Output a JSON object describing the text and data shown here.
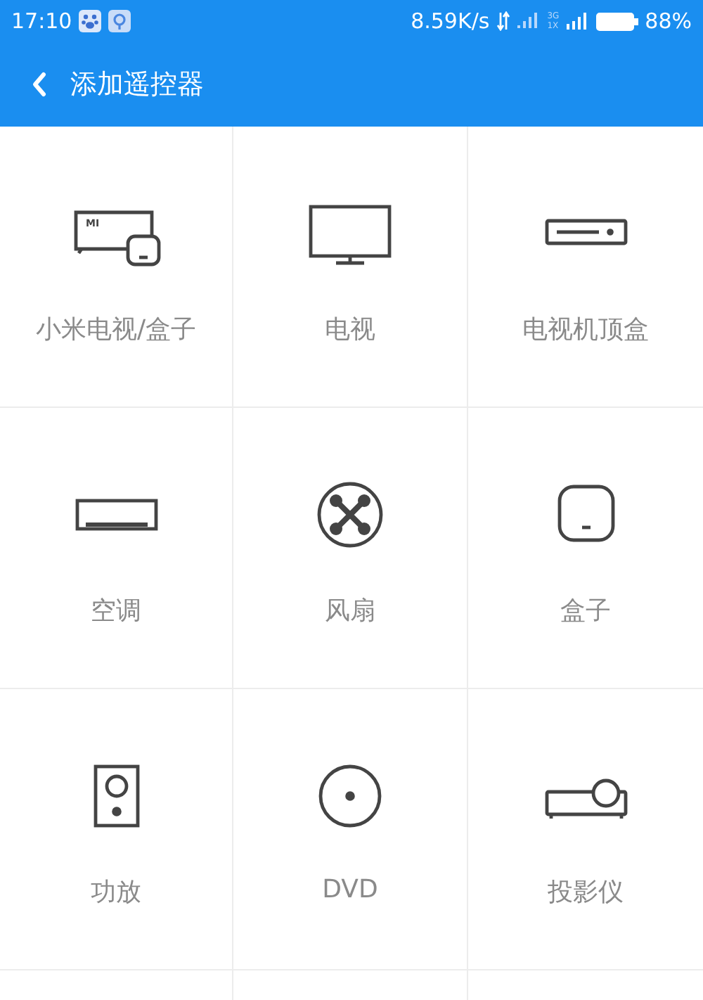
{
  "status_bar": {
    "time": "17:10",
    "speed": "8.59K/s",
    "network_top": "3G",
    "network_bottom": "1X",
    "battery": "88%"
  },
  "app_bar": {
    "title": "添加遥控器"
  },
  "devices": [
    {
      "label": "小米电视/盒子",
      "kind": "mitv",
      "badge": "MI"
    },
    {
      "label": "电视",
      "kind": "tv"
    },
    {
      "label": "电视机顶盒",
      "kind": "settopbox"
    },
    {
      "label": "空调",
      "kind": "aircon"
    },
    {
      "label": "风扇",
      "kind": "fan"
    },
    {
      "label": "盒子",
      "kind": "box"
    },
    {
      "label": "功放",
      "kind": "speaker"
    },
    {
      "label": "DVD",
      "kind": "dvd"
    },
    {
      "label": "投影仪",
      "kind": "projector"
    }
  ]
}
